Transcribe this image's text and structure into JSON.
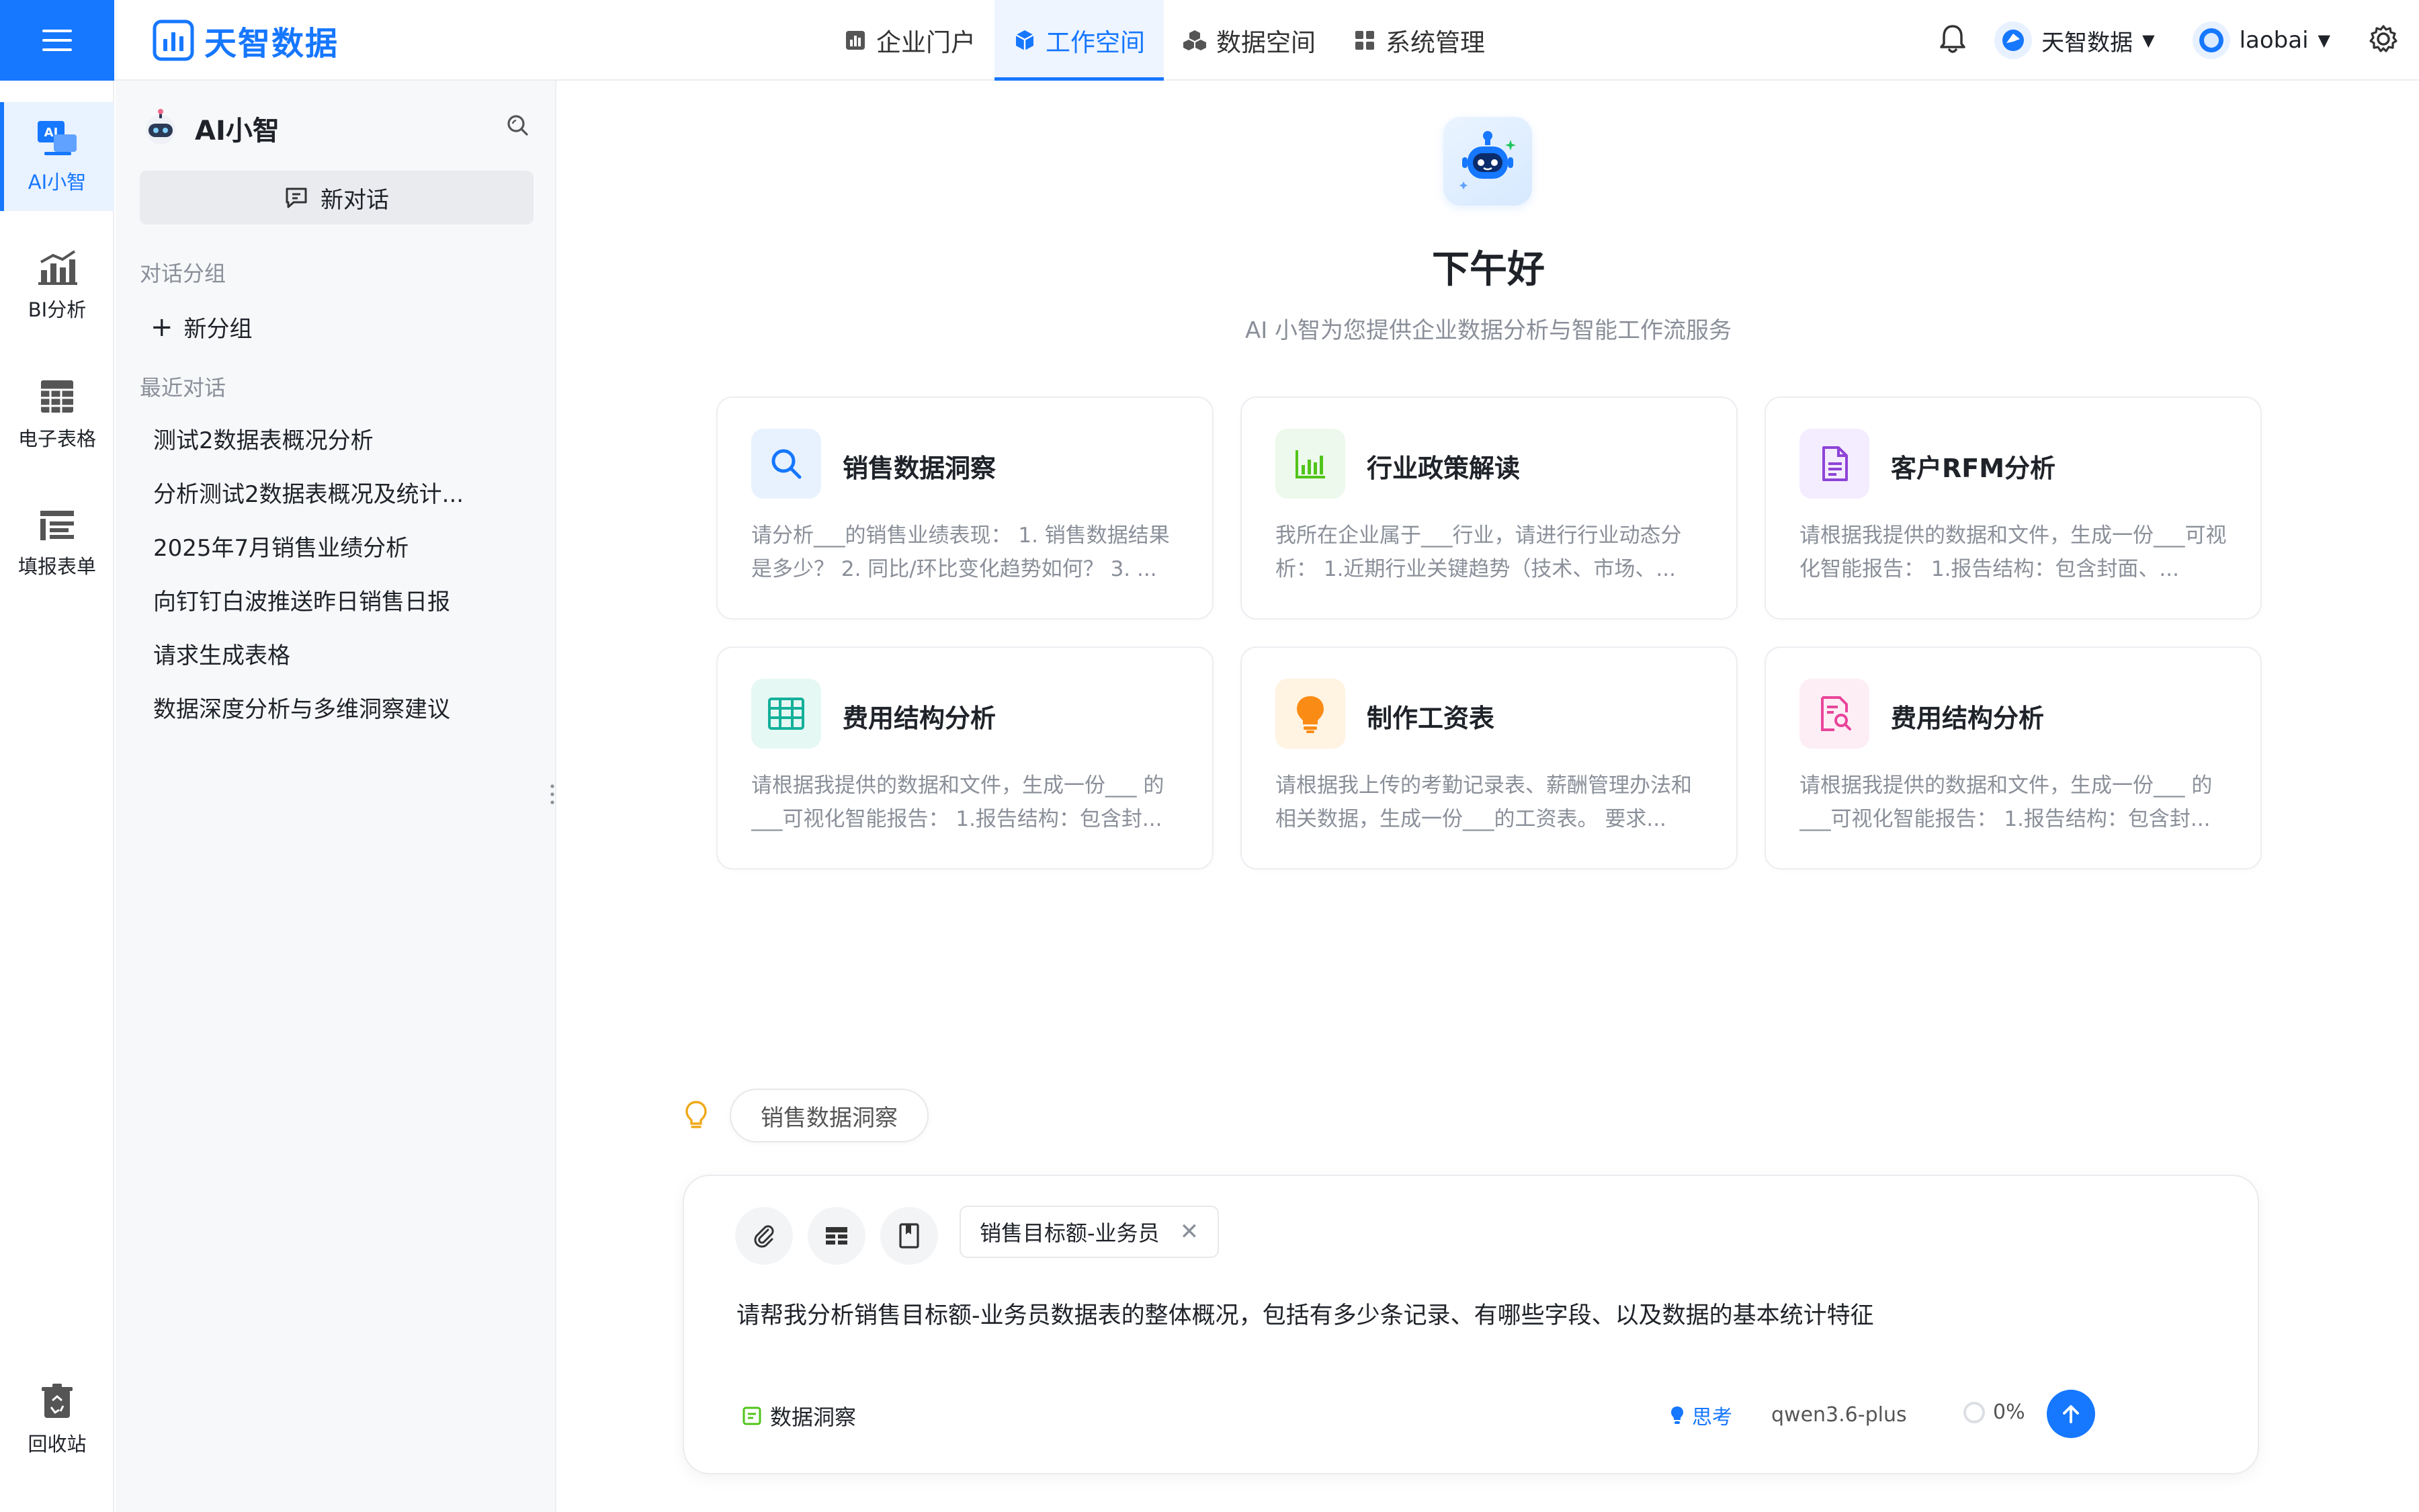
{
  "header": {
    "logo_text": "天智数据",
    "nav": [
      {
        "label": "企业门户",
        "icon": "chart-bar-icon"
      },
      {
        "label": "工作空间",
        "icon": "cube-icon",
        "active": true
      },
      {
        "label": "数据空间",
        "icon": "cubes-icon"
      },
      {
        "label": "系统管理",
        "icon": "grid-icon"
      }
    ],
    "org_name": "天智数据",
    "user_name": "laobai"
  },
  "rail": {
    "items": [
      {
        "label": "AI小智",
        "icon": "ai-assistant-icon",
        "active": true
      },
      {
        "label": "BI分析",
        "icon": "bi-chart-icon"
      },
      {
        "label": "电子表格",
        "icon": "spreadsheet-icon"
      },
      {
        "label": "填报表单",
        "icon": "form-icon"
      }
    ],
    "recycle_label": "回收站"
  },
  "sidebar": {
    "title": "AI小智",
    "new_chat_label": "新对话",
    "groups_label": "对话分组",
    "new_group_label": "新分组",
    "recent_label": "最近对话",
    "recent": [
      "测试2数据表概况分析",
      "分析测试2数据表概况及统计...",
      "2025年7月销售业绩分析",
      "向钉钉白波推送昨日销售日报",
      "请求生成表格",
      "数据深度分析与多维洞察建议"
    ]
  },
  "main": {
    "greeting": "下午好",
    "subtitle": "AI 小智为您提供企业数据分析与智能工作流服务",
    "cards": [
      {
        "title": "销售数据洞察",
        "icon": "search-icon",
        "desc": "请分析___的销售业绩表现： 1. 销售数据结果是多少？ 2. 同比/环比变化趋势如何？ 3. ..."
      },
      {
        "title": "行业政策解读",
        "icon": "bar-chart-icon",
        "desc": "我所在企业属于___行业，请进行行业动态分析： 1.近期行业关键趋势（技术、市场、..."
      },
      {
        "title": "客户RFM分析",
        "icon": "document-icon",
        "desc": "请根据我提供的数据和文件，生成一份___可视化智能报告： 1.报告结构：包含封面、..."
      },
      {
        "title": "费用结构分析",
        "icon": "table-icon",
        "desc": "请根据我提供的数据和文件，生成一份___ 的___可视化智能报告： 1.报告结构：包含封..."
      },
      {
        "title": "制作工资表",
        "icon": "lightbulb-icon",
        "desc": "请根据我上传的考勤记录表、薪酬管理办法和相关数据，生成一份___的工资表。 要求..."
      },
      {
        "title": "费用结构分析",
        "icon": "report-search-icon",
        "desc": "请根据我提供的数据和文件，生成一份___ 的___可视化智能报告： 1.报告结构：包含封..."
      }
    ],
    "suggestion_chip": "销售数据洞察",
    "composer": {
      "attachment_label": "销售目标额-业务员",
      "prompt": "请帮我分析销售目标额-业务员数据表的整体概况，包括有多少条记录、有哪些字段、以及数据的基本统计特征",
      "insight_label": "数据洞察",
      "think_label": "思考",
      "model_label": "qwen3.6-plus",
      "progress_label": "0%"
    }
  },
  "colors": {
    "accent": "#1677ff",
    "card_icon_bgs": [
      "#e8f2ff",
      "#ecf9ec",
      "#f4ecff",
      "#e6f8f4",
      "#fff3e2",
      "#fdeef5"
    ],
    "card_icon_colors": [
      "#1677ff",
      "#52c41a",
      "#8e44d6",
      "#13b09a",
      "#fa8c16",
      "#e8459a"
    ]
  }
}
